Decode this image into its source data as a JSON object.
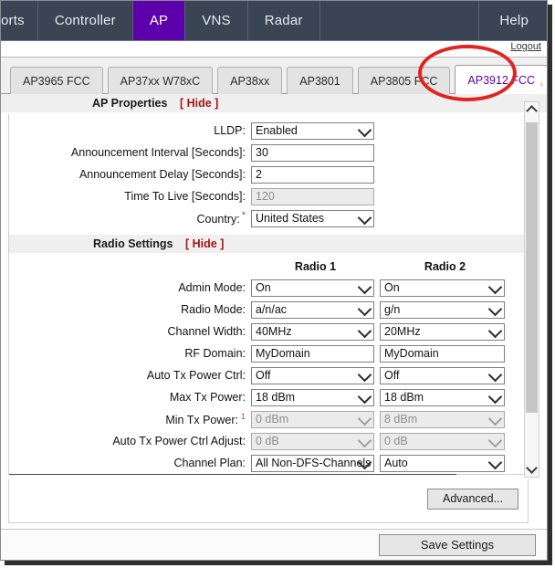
{
  "navbar": {
    "items": [
      {
        "label": "orts",
        "active": false,
        "clipped": true
      },
      {
        "label": "Controller",
        "active": false
      },
      {
        "label": "AP",
        "active": true
      },
      {
        "label": "VNS",
        "active": false
      },
      {
        "label": "Radar",
        "active": false
      }
    ],
    "help_label": "Help",
    "active_color": "#5c00ab",
    "background": "#3a4455"
  },
  "logout": {
    "label": "Logout"
  },
  "tabs": {
    "items": [
      {
        "label": "AP3965 FCC",
        "active": false
      },
      {
        "label": "AP37xx W78xC",
        "active": false
      },
      {
        "label": "AP38xx",
        "active": false
      },
      {
        "label": "AP3801",
        "active": false
      },
      {
        "label": "AP3805 FCC",
        "active": false
      },
      {
        "label": "AP3912 FCC",
        "active": true
      }
    ],
    "scroll_indicator": "›",
    "active_text_color": "#5c00ab"
  },
  "annotation": {
    "shape": "ellipse",
    "color": "#e02424",
    "target": "AP3912 FCC"
  },
  "ap_properties": {
    "title": "AP Properties",
    "toggle_label": "[ Hide ]",
    "fields": [
      {
        "label": "LLDP:",
        "value": "Enabled",
        "type": "select",
        "disabled": false,
        "required": false
      },
      {
        "label": "Announcement Interval [Seconds]:",
        "value": "30",
        "type": "text",
        "disabled": false,
        "required": false
      },
      {
        "label": "Announcement Delay [Seconds]:",
        "value": "2",
        "type": "text",
        "disabled": false,
        "required": false
      },
      {
        "label": "Time To Live [Seconds]:",
        "value": "120",
        "type": "text",
        "disabled": true,
        "required": false
      },
      {
        "label": "Country:",
        "value": "United States",
        "type": "select",
        "disabled": false,
        "required": true
      }
    ]
  },
  "radio_settings": {
    "title": "Radio Settings",
    "toggle_label": "[ Hide ]",
    "column_headers": [
      "Radio 1",
      "Radio 2"
    ],
    "rows": [
      {
        "label": "Admin Mode:",
        "type": "select",
        "disabled": false,
        "footnote": false,
        "radio1": "On",
        "radio2": "On"
      },
      {
        "label": "Radio Mode:",
        "type": "select",
        "disabled": false,
        "footnote": false,
        "radio1": "a/n/ac",
        "radio2": "g/n"
      },
      {
        "label": "Channel Width:",
        "type": "select",
        "disabled": false,
        "footnote": false,
        "radio1": "40MHz",
        "radio2": "20MHz"
      },
      {
        "label": "RF Domain:",
        "type": "text",
        "disabled": false,
        "footnote": false,
        "radio1": "MyDomain",
        "radio2": "MyDomain"
      },
      {
        "label": "Auto Tx Power Ctrl:",
        "type": "select",
        "disabled": false,
        "footnote": false,
        "radio1": "Off",
        "radio2": "Off"
      },
      {
        "label": "Max Tx Power:",
        "type": "select",
        "disabled": false,
        "footnote": false,
        "radio1": "18 dBm",
        "radio2": "18 dBm"
      },
      {
        "label": "Min Tx Power:",
        "type": "select",
        "disabled": true,
        "footnote": true,
        "footnote_marker": "1",
        "radio1": "0 dBm",
        "radio2": "8 dBm"
      },
      {
        "label": "Auto Tx Power Ctrl Adjust:",
        "type": "select",
        "disabled": true,
        "footnote": false,
        "radio1": "0 dB",
        "radio2": "0 dB"
      },
      {
        "label": "Channel Plan:",
        "type": "select",
        "disabled": false,
        "footnote": false,
        "radio1": "All Non-DFS-Channels",
        "radio2": "Auto"
      }
    ]
  },
  "footer": {
    "advanced_label": "Advanced...",
    "save_label": "Save Settings"
  }
}
